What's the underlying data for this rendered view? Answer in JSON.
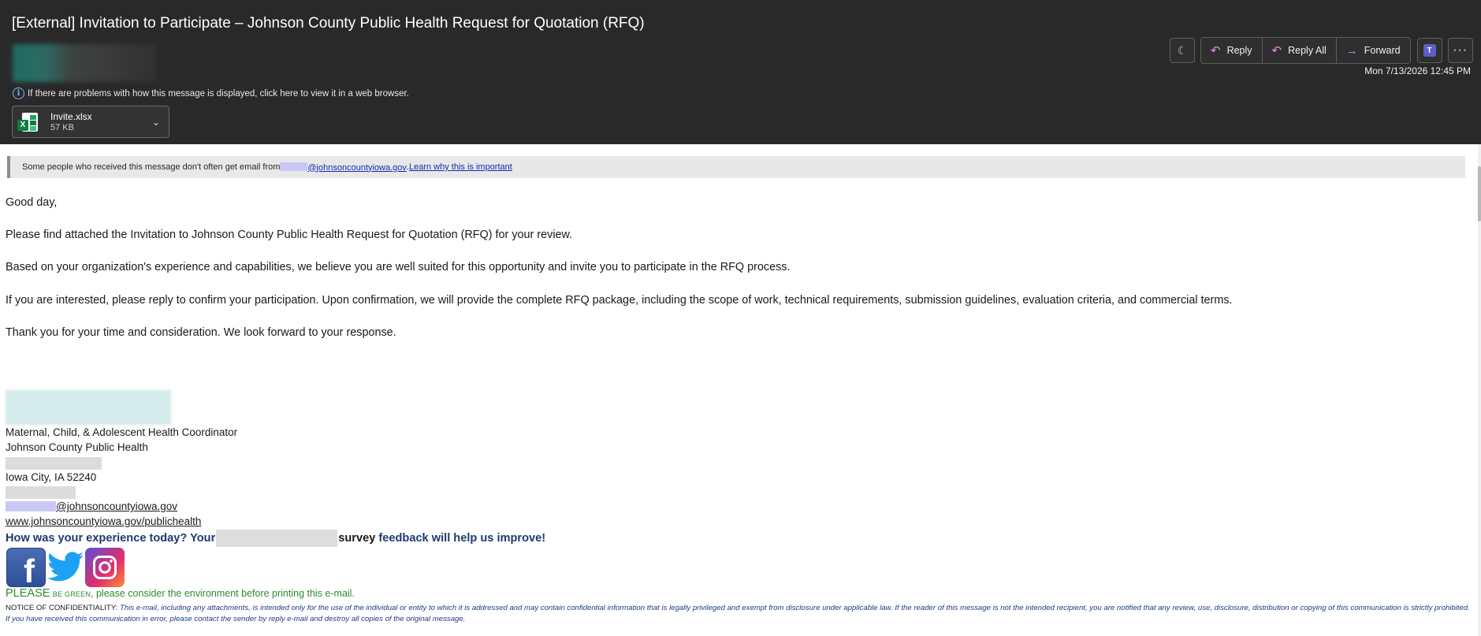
{
  "header": {
    "subject": "[External] Invitation to Participate – Johnson County Public Health Request for Quotation (RFQ)",
    "info_text": "If there are problems with how this message is displayed, click here to view it in a web browser.",
    "datetime": "Mon 7/13/2026 12:45 PM",
    "toolbar": {
      "reply_label": "Reply",
      "reply_all_label": "Reply All",
      "forward_label": "Forward"
    },
    "attachment": {
      "name": "Invite.xlsx",
      "size": "57 KB"
    }
  },
  "warning": {
    "text_prefix": "Some people who received this message don't often get email from ",
    "sender_domain": "@johnsoncountyiowa.gov",
    "separator": ". ",
    "learn_link": "Learn why this is important"
  },
  "body": {
    "greeting": "Good day,",
    "p1": "Please find attached the Invitation to Johnson County Public Health Request for Quotation (RFQ) for your review.",
    "p2": "Based on your organization's experience and capabilities, we believe you are well suited for this opportunity and invite you to participate in the RFQ process.",
    "p3": "If you are interested, please reply to confirm your participation. Upon confirmation, we will provide the complete RFQ package, including the scope of work, technical requirements, submission guidelines, evaluation criteria, and commercial terms.",
    "p4": "Thank you for your time and consideration. We look forward to your response."
  },
  "signature": {
    "title": "Maternal, Child, & Adolescent Health Coordinator",
    "org": "Johnson County Public Health",
    "city": "Iowa City, IA 52240",
    "email_domain": "@johnsoncountyiowa.gov",
    "website": "www.johnsoncountyiowa.gov/publichealth"
  },
  "survey": {
    "part1": "How was your experience today? Your",
    "part2": "survey",
    "part3": "feedback will help us improve!"
  },
  "green": {
    "please": "PLEASE",
    "be_green": "BE GREEN",
    "rest": ", please consider the environment before printing this e-mail."
  },
  "notice": {
    "lead": "NOTICE OF CONFIDENTIALITY:",
    "text": " This e-mail, including any attachments, is intended only for the use of the individual or entity to which it is addressed and may contain confidential information that is legally privileged and exempt from disclosure under applicable law.  If the reader of this message is not the intended recipient, you are notified that any review, use, disclosure, distribution or copying of this communication is strictly prohibited.  If you have received this communication in error, please contact the sender by reply e-mail and destroy all copies of the original message."
  },
  "icons": {
    "info": "info-icon",
    "theme": "moon-icon",
    "reply": "reply-arrow-icon",
    "reply_all": "reply-all-arrow-icon",
    "forward": "forward-arrow-icon",
    "teams": "teams-icon",
    "more": "more-dots-icon",
    "excel": "excel-file-icon",
    "chevron": "chevron-down-icon",
    "facebook": "facebook-icon",
    "twitter": "twitter-icon",
    "instagram": "instagram-icon"
  },
  "colors": {
    "header_bg": "#292929",
    "link": "#0b2fb0",
    "survey_blue": "#1e3a6e",
    "green": "#2e8b2e",
    "notice_blue": "#1e3a8a"
  }
}
